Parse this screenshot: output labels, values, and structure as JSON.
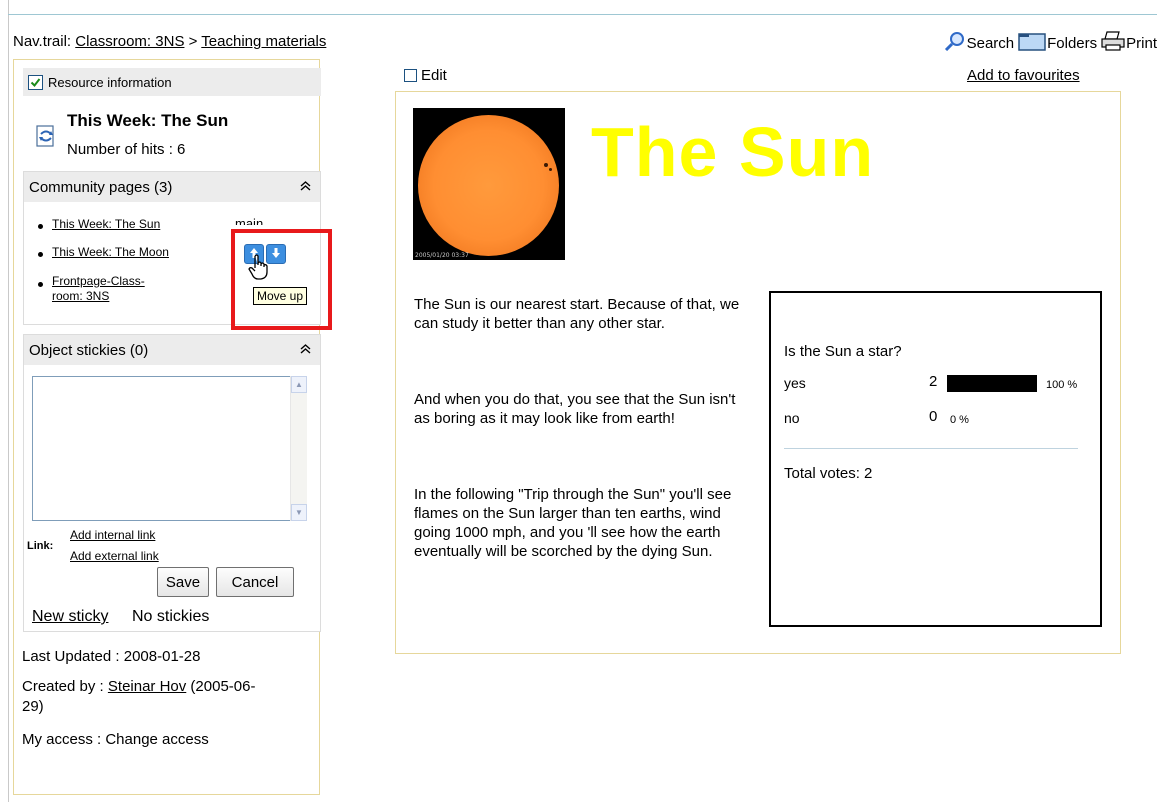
{
  "header": {
    "navtrail_prefix": "Nav.trail:",
    "crumbs": [
      "Classroom: 3NS",
      "Teaching materials"
    ],
    "separator": ">",
    "tools": [
      {
        "label": "Search",
        "icon": "search-icon"
      },
      {
        "label": "Folders",
        "icon": "folder-icon"
      },
      {
        "label": "Print",
        "icon": "printer-icon"
      }
    ]
  },
  "sidebar": {
    "resource_info": {
      "label": "Resource information",
      "title": "This Week: The Sun",
      "hits": "Number of hits : 6"
    },
    "community": {
      "heading": "Community pages (3)",
      "items": [
        {
          "label": "This Week: The Sun",
          "tag": "main"
        },
        {
          "label": "This Week: The Moon"
        },
        {
          "label": "Frontpage-Class-\nroom: 3NS"
        }
      ],
      "tooltip": "Move up"
    },
    "stickies": {
      "heading": "Object stickies (0)",
      "link_label": "Link:",
      "add_internal": "Add internal link",
      "add_external": "Add external link",
      "save": "Save",
      "cancel": "Cancel",
      "new_sticky": "New sticky",
      "status": "No stickies"
    },
    "meta": {
      "last_updated": "Last Updated : 2008-01-28",
      "created_prefix": "Created by : ",
      "created_by": "Steinar Hov",
      "created_suffix": " (2005-06-\n29)",
      "access": "My access : Change access"
    }
  },
  "main": {
    "edit_label": "Edit",
    "favourites": "Add to favourites",
    "title": "The Sun",
    "image_stamp": "2005/01/20 03:37",
    "paragraphs": [
      "The Sun is our nearest start. Because of that, we can study it better than any other star.",
      "And when you do that, you see that the Sun isn't as boring as it may look like from earth!",
      "In the following \"Trip through the Sun\" you'll see flames on the Sun larger than ten earths, wind going 1000 mph, and you 'll see  how the earth eventually will be scorched by the dying Sun."
    ],
    "poll": {
      "question": "Is the Sun a star?",
      "options": [
        {
          "label": "yes",
          "count": "2",
          "percent_text": "100 %",
          "fraction": 1.0
        },
        {
          "label": "no",
          "count": "0",
          "percent_text": "0 %",
          "fraction": 0.0
        }
      ],
      "total": "Total votes: 2"
    }
  }
}
